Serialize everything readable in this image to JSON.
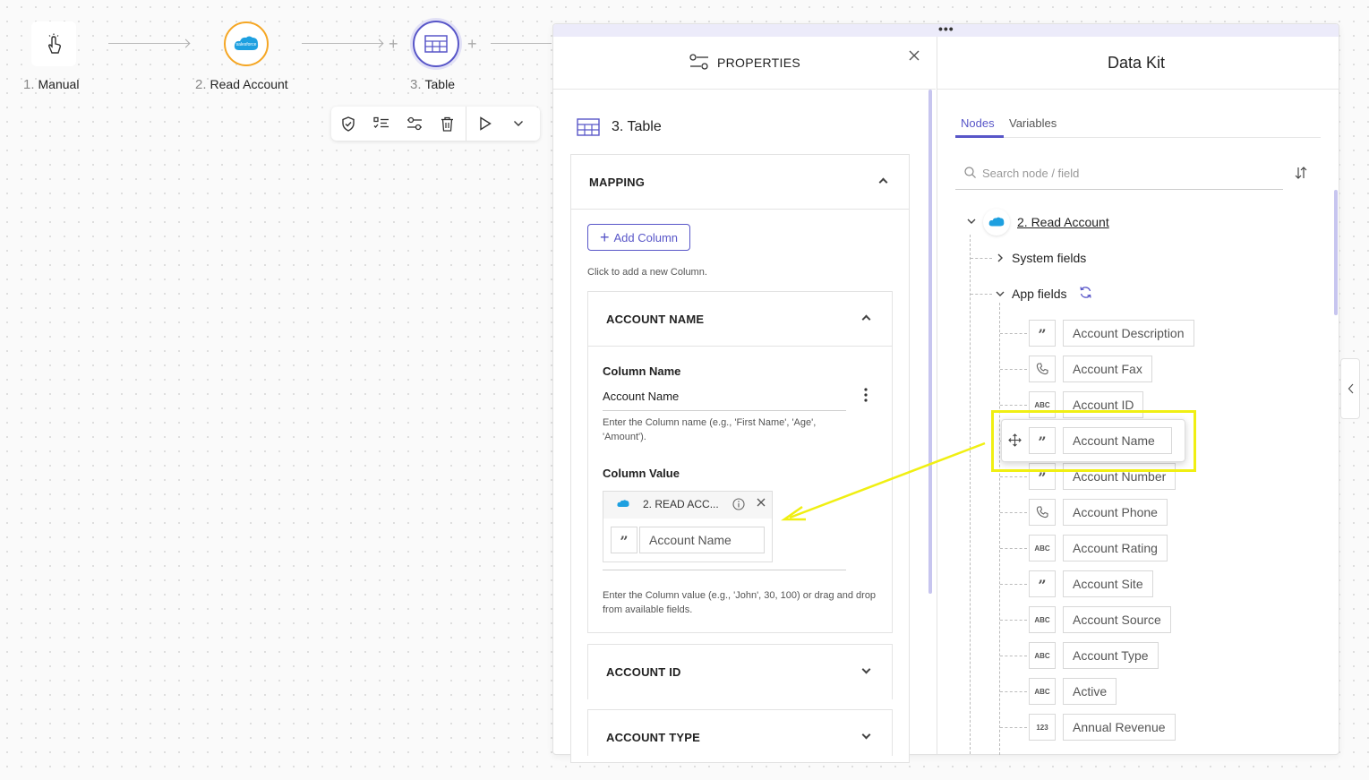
{
  "workflow": {
    "nodes": [
      {
        "num": "1.",
        "label": "Manual",
        "icon": "hand-pointer-icon"
      },
      {
        "num": "2.",
        "label": "Read Account",
        "icon": "salesforce-icon"
      },
      {
        "num": "3.",
        "label": "Table",
        "icon": "table-icon"
      }
    ],
    "toolbar": [
      "shield-check-icon",
      "checklist-icon",
      "settings-sliders-icon",
      "trash-icon",
      "play-icon",
      "chevron-down-icon"
    ]
  },
  "properties": {
    "title": "PROPERTIES",
    "node_title": "3. Table",
    "mapping": {
      "label": "MAPPING",
      "add_button": "Add Column",
      "add_help": "Click to add a new Column.",
      "columns": [
        {
          "header": "ACCOUNT NAME",
          "column_name_label": "Column Name",
          "column_name_value": "Account Name",
          "column_name_help": "Enter the Column name (e.g., 'First Name', 'Age', 'Amount').",
          "column_value_label": "Column Value",
          "chip_source": "2. READ ACC...",
          "chip_field": "Account Name",
          "column_value_help": "Enter the Column value (e.g., 'John', 30, 100) or drag and drop from available fields."
        },
        {
          "header": "ACCOUNT ID"
        },
        {
          "header": "ACCOUNT TYPE"
        }
      ]
    }
  },
  "data_kit": {
    "title": "Data Kit",
    "tabs": [
      {
        "label": "Nodes",
        "active": true
      },
      {
        "label": "Variables",
        "active": false
      }
    ],
    "search_placeholder": "Search node / field",
    "node": "2. Read Account",
    "system_fields": "System fields",
    "app_fields": "App fields",
    "fields": [
      {
        "type": "quote",
        "name": "Account Description"
      },
      {
        "type": "phone",
        "name": "Account Fax"
      },
      {
        "type": "ABC",
        "name": "Account ID"
      },
      {
        "type": "quote",
        "name": "Account Name"
      },
      {
        "type": "quote",
        "name": "Account Number"
      },
      {
        "type": "phone",
        "name": "Account Phone"
      },
      {
        "type": "ABC",
        "name": "Account Rating"
      },
      {
        "type": "quote",
        "name": "Account Site"
      },
      {
        "type": "ABC",
        "name": "Account Source"
      },
      {
        "type": "ABC",
        "name": "Account Type"
      },
      {
        "type": "ABC",
        "name": "Active"
      },
      {
        "type": "123",
        "name": "Annual Revenue"
      }
    ],
    "dragging_field": "Account Name"
  },
  "colors": {
    "accent": "#5856c8",
    "salesforce": "#1ea0e0",
    "trigger_ring": "#f5a623",
    "highlight": "#f0ef12"
  }
}
